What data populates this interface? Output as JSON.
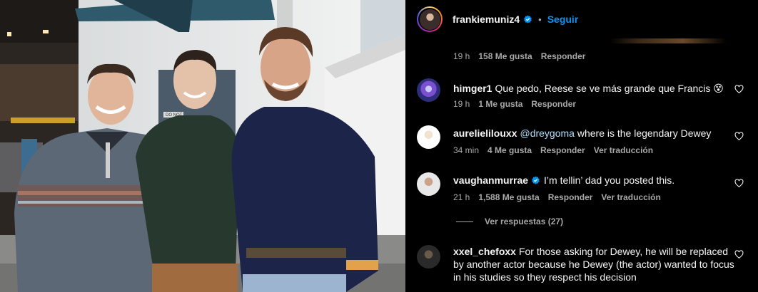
{
  "post": {
    "username": "frankiemuniz4",
    "follow_label": "Seguir",
    "separator": "•"
  },
  "first_meta": {
    "time": "19 h",
    "likes": "158 Me gusta",
    "reply": "Responder"
  },
  "comments": [
    {
      "username": "himger1",
      "text": "Que pedo, Reese se ve más grande que Francis 😵",
      "time": "19 h",
      "likes": "1 Me gusta",
      "reply": "Responder",
      "translate": ""
    },
    {
      "username": "aurelielilouxx",
      "mention": "@dreygoma",
      "text": " where is the legendary Dewey",
      "time": "34 min",
      "likes": "4 Me gusta",
      "reply": "Responder",
      "translate": "Ver traducción"
    },
    {
      "username": "vaughanmurrae",
      "text": "I’m tellin’ dad you posted this.",
      "time": "21 h",
      "likes": "1,588 Me gusta",
      "reply": "Responder",
      "translate": "Ver traducción"
    },
    {
      "username": "xxel_chefoxx",
      "text": "For those asking for Dewey, he will be replaced by another actor because he Dewey (the actor) wanted to focus in his studies so they respect his decision"
    }
  ],
  "view_replies": "Ver respuestas (27)",
  "colors": {
    "link_blue": "#0095f6",
    "muted": "#a8a8a8",
    "background": "#000000"
  },
  "icons": {
    "verified": "verified-badge-icon",
    "like": "heart-outline-icon"
  },
  "photo": {
    "sign_text": "DO NOT"
  }
}
